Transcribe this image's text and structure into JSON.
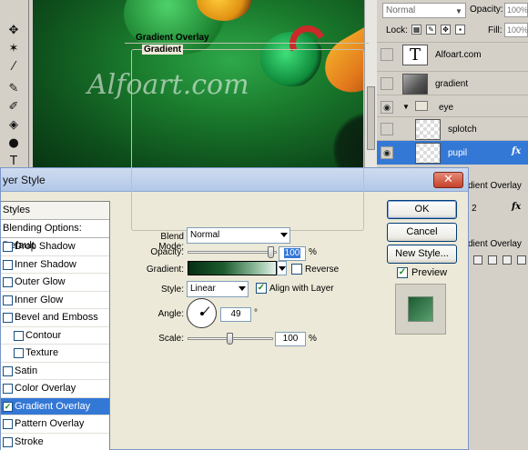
{
  "canvas": {
    "watermark": "Alfoart.com"
  },
  "layers_panel": {
    "blend_mode": "Normal",
    "opacity_label": "Opacity:",
    "opacity_value": "100%",
    "lock_label": "Lock:",
    "fill_label": "Fill:",
    "fill_value": "100%",
    "layers": [
      {
        "name": "Alfoart.com",
        "thumb": "T"
      },
      {
        "name": "gradient"
      },
      {
        "name": "eye"
      },
      {
        "name": "splotch"
      },
      {
        "name": "pupil",
        "fx": "fx"
      }
    ],
    "fragment_1": "dient Overlay",
    "fragment_num": "2",
    "fragment_fx": "fx",
    "fragment_2": "dient Overlay"
  },
  "dialog": {
    "title": "yer Style",
    "close_glyph": "✕",
    "styles_header": "Styles",
    "blending_options": "Blending Options: Default",
    "style_items": [
      {
        "label": "Drop Shadow",
        "checked": false
      },
      {
        "label": "Inner Shadow",
        "checked": false
      },
      {
        "label": "Outer Glow",
        "checked": false
      },
      {
        "label": "Inner Glow",
        "checked": false
      },
      {
        "label": "Bevel and Emboss",
        "checked": false
      },
      {
        "label": "Contour",
        "checked": false,
        "sub": true
      },
      {
        "label": "Texture",
        "checked": false,
        "sub": true
      },
      {
        "label": "Satin",
        "checked": false
      },
      {
        "label": "Color Overlay",
        "checked": false
      },
      {
        "label": "Gradient Overlay",
        "checked": true,
        "active": true
      },
      {
        "label": "Pattern Overlay",
        "checked": false
      },
      {
        "label": "Stroke",
        "checked": false
      }
    ],
    "section_title": "Gradient Overlay",
    "group_title": "Gradient",
    "blend_mode_label": "Blend Mode:",
    "blend_mode_value": "Normal",
    "opacity_label": "Opacity:",
    "opacity_value": "100",
    "opacity_percent": 100,
    "opacity_unit": "%",
    "gradient_label": "Gradient:",
    "reverse_label": "Reverse",
    "reverse_checked": false,
    "style_label": "Style:",
    "style_value": "Linear",
    "align_label": "Align with Layer",
    "align_checked": true,
    "angle_label": "Angle:",
    "angle_value": "49",
    "angle_unit": "°",
    "scale_label": "Scale:",
    "scale_value": "100",
    "scale_percent": 100,
    "scale_unit": "%",
    "buttons": {
      "ok": "OK",
      "cancel": "Cancel",
      "new_style": "New Style..."
    },
    "preview_label": "Preview",
    "preview_checked": true
  },
  "colors": {
    "selection": "#3478d6",
    "gradient_dark": "#062d14",
    "gradient_light": "#e8f0ea"
  }
}
